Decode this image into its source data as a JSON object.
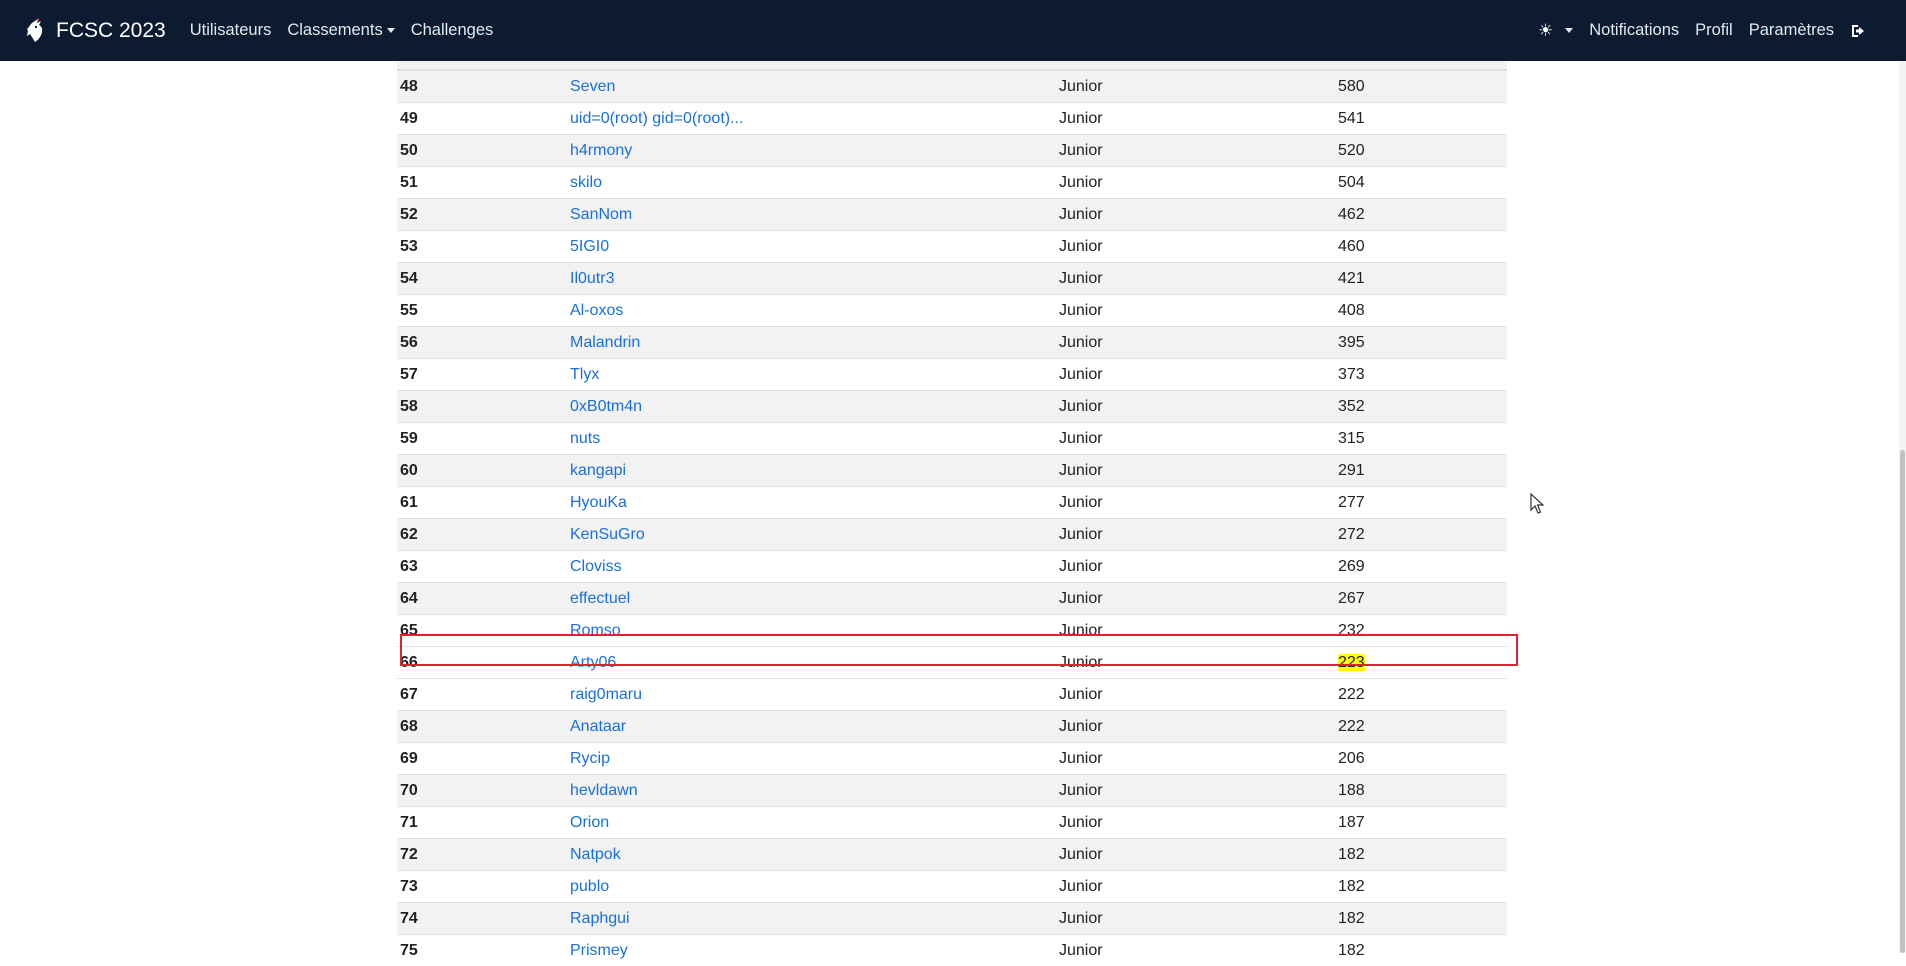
{
  "nav": {
    "brand": "FCSC 2023",
    "left_items": [
      "Utilisateurs",
      "Classements",
      "Challenges"
    ],
    "right_items": [
      "Notifications",
      "Profil",
      "Paramètres"
    ],
    "theme_icon": "sun-icon",
    "logout_icon": "logout-icon"
  },
  "rows": [
    {
      "rank": "48",
      "user": "Seven",
      "category": "Junior",
      "score": "580"
    },
    {
      "rank": "49",
      "user": "uid=0(root) gid=0(root)...",
      "category": "Junior",
      "score": "541"
    },
    {
      "rank": "50",
      "user": "h4rmony",
      "category": "Junior",
      "score": "520"
    },
    {
      "rank": "51",
      "user": "skilo",
      "category": "Junior",
      "score": "504"
    },
    {
      "rank": "52",
      "user": "SanNom",
      "category": "Junior",
      "score": "462"
    },
    {
      "rank": "53",
      "user": "5IGI0",
      "category": "Junior",
      "score": "460"
    },
    {
      "rank": "54",
      "user": "Il0utr3",
      "category": "Junior",
      "score": "421"
    },
    {
      "rank": "55",
      "user": "Al-oxos",
      "category": "Junior",
      "score": "408"
    },
    {
      "rank": "56",
      "user": "Malandrin",
      "category": "Junior",
      "score": "395"
    },
    {
      "rank": "57",
      "user": "Tlyx",
      "category": "Junior",
      "score": "373"
    },
    {
      "rank": "58",
      "user": "0xB0tm4n",
      "category": "Junior",
      "score": "352"
    },
    {
      "rank": "59",
      "user": "nuts",
      "category": "Junior",
      "score": "315"
    },
    {
      "rank": "60",
      "user": "kangapi",
      "category": "Junior",
      "score": "291"
    },
    {
      "rank": "61",
      "user": "HyouKa",
      "category": "Junior",
      "score": "277"
    },
    {
      "rank": "62",
      "user": "KenSuGro",
      "category": "Junior",
      "score": "272"
    },
    {
      "rank": "63",
      "user": "Cloviss",
      "category": "Junior",
      "score": "269"
    },
    {
      "rank": "64",
      "user": "effectuel",
      "category": "Junior",
      "score": "267"
    },
    {
      "rank": "65",
      "user": "Romso",
      "category": "Junior",
      "score": "232"
    },
    {
      "rank": "66",
      "user": "Arty06",
      "category": "Junior",
      "score": "223",
      "highlighted": true
    },
    {
      "rank": "67",
      "user": "raig0maru",
      "category": "Junior",
      "score": "222"
    },
    {
      "rank": "68",
      "user": "Anataar",
      "category": "Junior",
      "score": "222"
    },
    {
      "rank": "69",
      "user": "Rycip",
      "category": "Junior",
      "score": "206"
    },
    {
      "rank": "70",
      "user": "hevldawn",
      "category": "Junior",
      "score": "188"
    },
    {
      "rank": "71",
      "user": "Orion",
      "category": "Junior",
      "score": "187"
    },
    {
      "rank": "72",
      "user": "Natpok",
      "category": "Junior",
      "score": "182"
    },
    {
      "rank": "73",
      "user": "publo",
      "category": "Junior",
      "score": "182"
    },
    {
      "rank": "74",
      "user": "Raphgui",
      "category": "Junior",
      "score": "182"
    },
    {
      "rank": "75",
      "user": "Prismey",
      "category": "Junior",
      "score": "182"
    }
  ],
  "colors": {
    "navbar_bg": "#0d1b30",
    "link": "#1a6fd8",
    "highlight_border": "#d9262e",
    "highlight_marker": "#ffff00"
  }
}
